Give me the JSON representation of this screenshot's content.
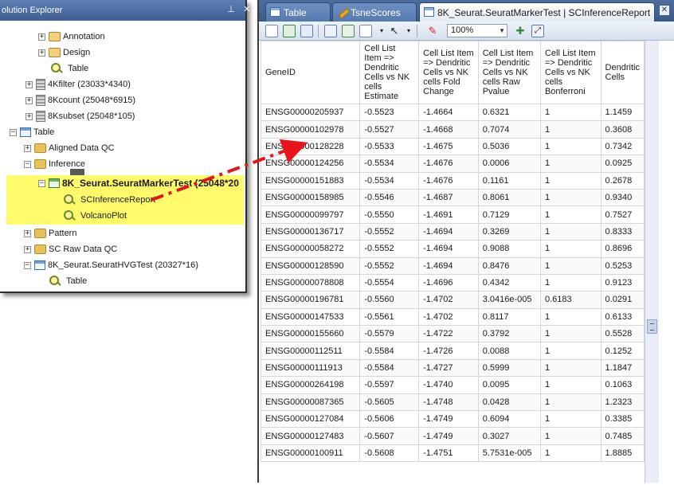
{
  "explorer": {
    "title": "olution Explorer",
    "pin_glyph": "⊥",
    "close_glyph": "✕",
    "nodes": [
      {
        "label": "Annotation"
      },
      {
        "label": "Design"
      },
      {
        "label": "Table"
      },
      {
        "label": "4Kfilter (23033*4340)"
      },
      {
        "label": "8Kcount (25048*6915)"
      },
      {
        "label": "8Ksubset (25048*105)"
      },
      {
        "label": "Table"
      },
      {
        "label": "Aligned Data QC"
      },
      {
        "label": "Inference"
      },
      {
        "label": "8K_Seurat.SeuratMarkerTest (25048*20"
      },
      {
        "label": "SCInferenceReport"
      },
      {
        "label": "VolcanoPlot"
      },
      {
        "label": "Pattern"
      },
      {
        "label": "SC Raw Data QC"
      },
      {
        "label": "8K_Seurat.SeuratHVGTest (20327*16)"
      },
      {
        "label": "Table"
      }
    ]
  },
  "report": {
    "tabs": [
      {
        "label": "Table"
      },
      {
        "label": "TsneScores"
      },
      {
        "label": "8K_Seurat.SeuratMarkerTest | SCInferenceReport"
      }
    ],
    "close_glyph": "✕",
    "toolbar": {
      "zoom": "100%"
    },
    "columns": [
      "GeneID",
      "Cell List Item => Dendritic Cells vs NK cells Estimate",
      "Cell List Item => Dendritic Cells vs NK cells Fold Change",
      "Cell List Item => Dendritic Cells vs NK cells Raw Pvalue",
      "Cell List Item => Dendritic Cells vs NK cells Bonferroni",
      "Dendritic Cells"
    ],
    "rows": [
      [
        "ENSG00000205937",
        "-0.5523",
        "-1.4664",
        "0.6321",
        "1",
        "1.1459"
      ],
      [
        "ENSG00000102978",
        "-0.5527",
        "-1.4668",
        "0.7074",
        "1",
        "0.3608"
      ],
      [
        "ENSG00000128228",
        "-0.5533",
        "-1.4675",
        "0.5036",
        "1",
        "0.7342"
      ],
      [
        "ENSG00000124256",
        "-0.5534",
        "-1.4676",
        "0.0006",
        "1",
        "0.0925"
      ],
      [
        "ENSG00000151883",
        "-0.5534",
        "-1.4676",
        "0.1161",
        "1",
        "0.2678"
      ],
      [
        "ENSG00000158985",
        "-0.5546",
        "-1.4687",
        "0.8061",
        "1",
        "0.9340"
      ],
      [
        "ENSG00000099797",
        "-0.5550",
        "-1.4691",
        "0.7129",
        "1",
        "0.7527"
      ],
      [
        "ENSG00000136717",
        "-0.5552",
        "-1.4694",
        "0.3269",
        "1",
        "0.8333"
      ],
      [
        "ENSG00000058272",
        "-0.5552",
        "-1.4694",
        "0.9088",
        "1",
        "0.8696"
      ],
      [
        "ENSG00000128590",
        "-0.5552",
        "-1.4694",
        "0.8476",
        "1",
        "0.5253"
      ],
      [
        "ENSG00000078808",
        "-0.5554",
        "-1.4696",
        "0.4342",
        "1",
        "0.9123"
      ],
      [
        "ENSG00000196781",
        "-0.5560",
        "-1.4702",
        "3.0416e-005",
        "0.6183",
        "0.0291"
      ],
      [
        "ENSG00000147533",
        "-0.5561",
        "-1.4702",
        "0.8117",
        "1",
        "0.6133"
      ],
      [
        "ENSG00000155660",
        "-0.5579",
        "-1.4722",
        "0.3792",
        "1",
        "0.5528"
      ],
      [
        "ENSG00000112511",
        "-0.5584",
        "-1.4726",
        "0.0088",
        "1",
        "0.1252"
      ],
      [
        "ENSG00000111913",
        "-0.5584",
        "-1.4727",
        "0.5999",
        "1",
        "1.1847"
      ],
      [
        "ENSG00000264198",
        "-0.5597",
        "-1.4740",
        "0.0095",
        "1",
        "0.1063"
      ],
      [
        "ENSG00000087365",
        "-0.5605",
        "-1.4748",
        "0.0428",
        "1",
        "1.2323"
      ],
      [
        "ENSG00000127084",
        "-0.5606",
        "-1.4749",
        "0.6094",
        "1",
        "0.3385"
      ],
      [
        "ENSG00000127483",
        "-0.5607",
        "-1.4749",
        "0.3027",
        "1",
        "0.7485"
      ],
      [
        "ENSG00000100911",
        "-0.5608",
        "-1.4751",
        "5.7531e-005",
        "1",
        "1.8885"
      ]
    ]
  },
  "colors": {
    "highlight": "#fffb6a",
    "arrow": "#e8141c",
    "title_bar": "#3f5f93"
  }
}
